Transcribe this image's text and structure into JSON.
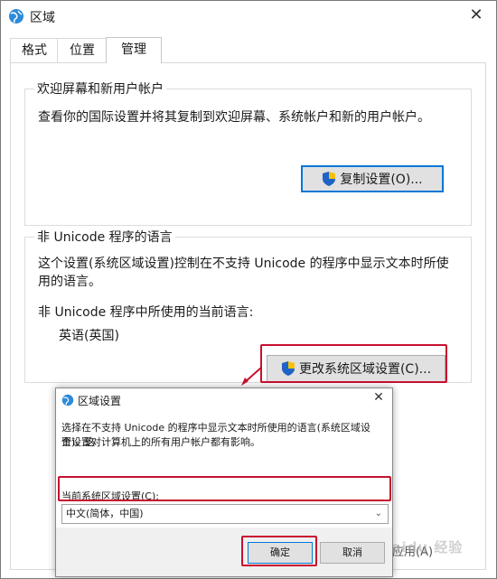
{
  "window": {
    "title": "区域",
    "close_glyph": "✕"
  },
  "tabs": [
    {
      "label": "格式"
    },
    {
      "label": "位置"
    },
    {
      "label": "管理"
    }
  ],
  "welcome": {
    "title": "欢迎屏幕和新用户帐户",
    "description": "查看你的国际设置并将其复制到欢迎屏幕、系统帐户和新的用户帐户。",
    "button": "复制设置(O)..."
  },
  "non_unicode": {
    "title": "非 Unicode 程序的语言",
    "description_line1": "这个设置(系统区域设置)控制在不支持 Unicode 的程序中显示文本时所使",
    "description_line2": "用的语言。",
    "current_label": "非 Unicode 程序中所使用的当前语言:",
    "current_value": "英语(英国)",
    "button": "更改系统区域设置(C)..."
  },
  "dialog": {
    "title": "区域设置",
    "close_glyph": "✕",
    "description_line1": "选择在不支持 Unicode 的程序中显示文本时所使用的语言(系统区域设置)。这",
    "description_line2": "个设置对计算机上的所有用户帐户都有影响。",
    "select_label": "当前系统区域设置(C):",
    "select_value": "中文(简体，中国)",
    "ok": "确定",
    "cancel": "取消"
  },
  "partially_hidden_button": "应用(A)",
  "watermark": "Baidu 经验",
  "colors": {
    "highlight_red": "#c8102e",
    "focus_blue": "#0078d7"
  }
}
